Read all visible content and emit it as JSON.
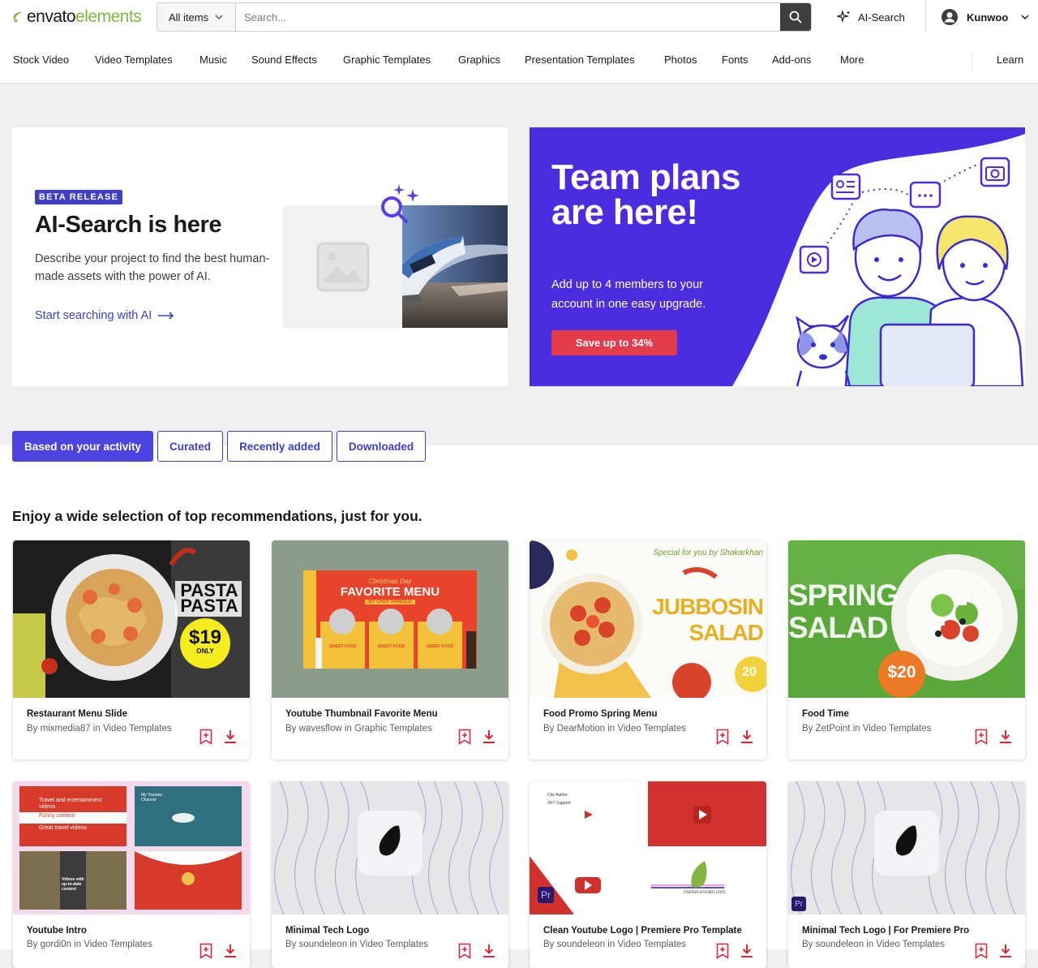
{
  "brand": {
    "envato": "envato",
    "elements": "elements"
  },
  "search": {
    "category": "All items",
    "placeholder": "Search..."
  },
  "header": {
    "ai_search": "AI-Search",
    "username": "Kunwoo"
  },
  "nav": [
    "Stock Video",
    "Video Templates",
    "Music",
    "Sound Effects",
    "Graphic Templates",
    "Graphics",
    "Presentation Templates",
    "Photos",
    "Fonts",
    "Add-ons",
    "More"
  ],
  "nav_right": "Learn",
  "promo_ai": {
    "badge": "BETA RELEASE",
    "title": "AI-Search is here",
    "description": "Describe your project to find the best human-made assets with the power of AI.",
    "link": "Start searching with AI"
  },
  "promo_team": {
    "title": "Team plans are here!",
    "description": "Add up to 4 members to your account in one easy upgrade.",
    "button": "Save up to 34%"
  },
  "tabs": [
    "Based on your activity",
    "Curated",
    "Recently added",
    "Downloaded"
  ],
  "section_title": "Enjoy a wide selection of top recommendations, just for you.",
  "cards": [
    {
      "title": "Restaurant Menu Slide",
      "by": "By mixmedia87 in Video Templates",
      "thumb_text1": "PASTA",
      "thumb_text2": "PASTA",
      "price": "$19",
      "price_sub": "ONLY"
    },
    {
      "title": "Youtube Thumbnail Favorite Menu",
      "by": "By wavesflow in Graphic Templates",
      "thumb_text1": "Christmas Day",
      "thumb_text2": "FAVORITE MENU",
      "thumb_text3": "BY CHEF ARNOLD",
      "thumb_text4": "SWEET FOOD"
    },
    {
      "title": "Food Promo Spring Menu",
      "by": "By DearMotion in Video Templates",
      "thumb_text1": "Special for you by Shakarkhan",
      "thumb_text2": "JUBBOSIN",
      "thumb_text3": "SALAD",
      "price": "20"
    },
    {
      "title": "Food Time",
      "by": "By ZetPoint in Video Templates",
      "thumb_text1": "SPRING",
      "thumb_text2": "SALAD",
      "price": "$20"
    },
    {
      "title": "Youtube Intro",
      "by": "By gordi0n in Video Templates",
      "thumb_text1": "Travel and entertainment videos",
      "thumb_text2": "Funny content",
      "thumb_text3": "Great travel videos",
      "thumb_text4": "Videos with up-to-date content",
      "thumb_text5": "My Youtube Channel"
    },
    {
      "title": "Minimal Tech Logo",
      "by": "By soundeleon in Video Templates"
    },
    {
      "title": "Clean Youtube Logo | Premiere Pro Template",
      "by": "By soundeleon in Video Templates",
      "thumb_text1": "Cite Author",
      "thumb_text2": "24/7 Support",
      "thumb_text3": "market.envato.com",
      "badge": "Pr"
    },
    {
      "title": "Minimal Tech Logo | For Premiere Pro",
      "by": "By soundeleon in Video Templates",
      "badge": "Pr"
    }
  ],
  "colors": {
    "brand_green": "#82b541",
    "accent_blue": "#4b44e0",
    "team_purple": "#4a2de0",
    "cta_red": "#e33b4b",
    "icon_red": "#d9273a"
  }
}
